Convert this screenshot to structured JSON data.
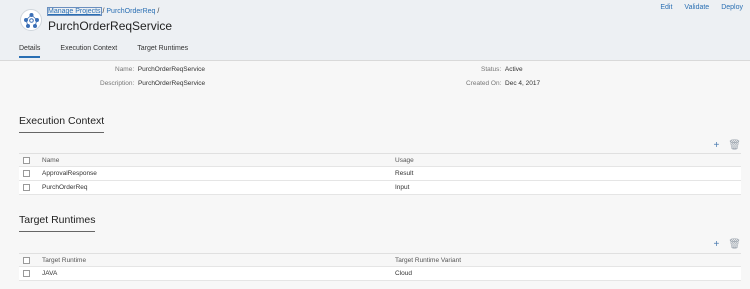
{
  "header": {
    "breadcrumb": {
      "link1": "Manage Projects",
      "sep1": "/",
      "link2": "PurchOrderReq",
      "sep2": "/"
    },
    "title": "PurchOrderReqService",
    "actions": [
      "Edit",
      "Validate",
      "Deploy"
    ]
  },
  "tabs": [
    {
      "label": "Details",
      "active": true
    },
    {
      "label": "Execution Context",
      "active": false
    },
    {
      "label": "Target Runtimes",
      "active": false
    }
  ],
  "details": {
    "name_label": "Name:",
    "name_value": "PurchOrderReqService",
    "description_label": "Description:",
    "description_value": "PurchOrderReqService",
    "status_label": "Status:",
    "status_value": "Active",
    "created_label": "Created On:",
    "created_value": "Dec 4, 2017"
  },
  "execution_context": {
    "title": "Execution Context",
    "columns": [
      "Name",
      "Usage"
    ],
    "rows": [
      {
        "name": "ApprovalResponse",
        "usage": "Result"
      },
      {
        "name": "PurchOrderReq",
        "usage": "Input"
      }
    ]
  },
  "target_runtimes": {
    "title": "Target Runtimes",
    "columns": [
      "Target Runtime",
      "Target Runtime Variant"
    ],
    "rows": [
      {
        "runtime": "JAVA",
        "variant": "Cloud"
      }
    ]
  },
  "icons": {
    "add": "+",
    "delete": "🗑"
  },
  "colors": {
    "link": "#2a6fb3",
    "header_bg": "#edf0f3",
    "logo": "#3b6fb6"
  }
}
